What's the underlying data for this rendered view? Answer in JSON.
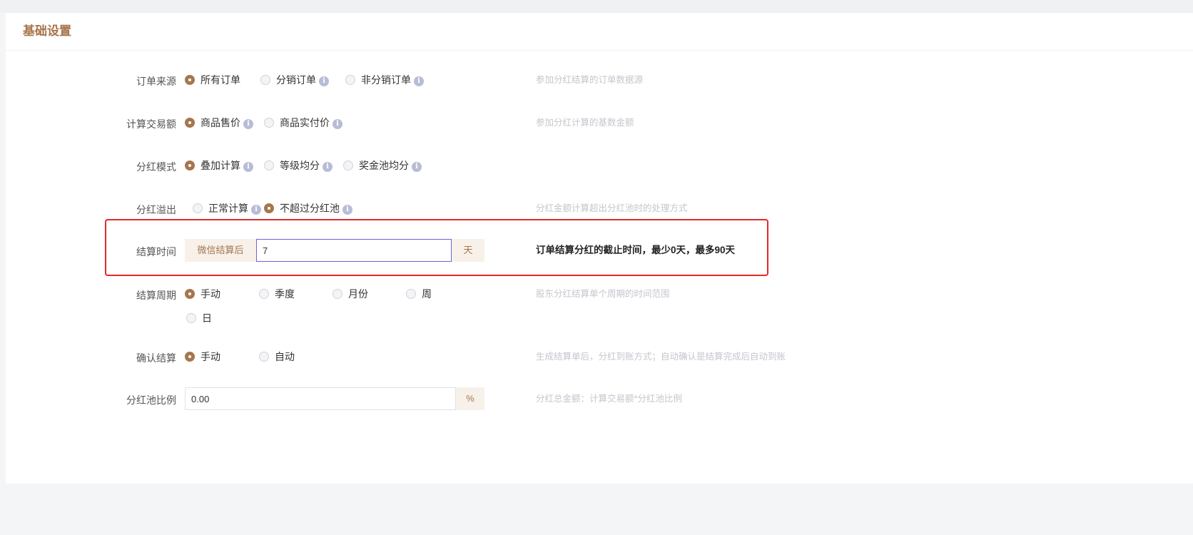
{
  "page": {
    "section_title": "基础设置"
  },
  "form": {
    "order_source": {
      "label": "订单来源",
      "options": [
        "所有订单",
        "分销订单",
        "非分销订单"
      ],
      "selected": "所有订单",
      "hint": "参加分红结算的订单数据源"
    },
    "trade_amount": {
      "label": "计算交易额",
      "options": [
        "商品售价",
        "商品实付价"
      ],
      "selected": "商品售价",
      "hint": "参加分红计算的基数金额"
    },
    "bonus_mode": {
      "label": "分红模式",
      "options": [
        "叠加计算",
        "等级均分",
        "奖金池均分"
      ],
      "selected": "叠加计算",
      "hint": ""
    },
    "bonus_overflow": {
      "label": "分红溢出",
      "options": [
        "正常计算",
        "不超过分红池"
      ],
      "selected": "不超过分红池",
      "hint": "分红金额计算超出分红池时的处理方式"
    },
    "settle_time": {
      "label": "结算时间",
      "prefix": "微信结算后",
      "value": "7",
      "suffix": "天",
      "hint": "订单结算分红的截止时间，最少0天，最多90天"
    },
    "settle_cycle": {
      "label": "结算周期",
      "options": [
        "手动",
        "季度",
        "月份",
        "周",
        "日"
      ],
      "selected": "手动",
      "hint": "股东分红结算单个周期的时间范围"
    },
    "confirm_settle": {
      "label": "确认结算",
      "options": [
        "手动",
        "自动"
      ],
      "selected": "手动",
      "hint": "生成结算单后，分红到账方式；自动确认是结算完成后自动到账"
    },
    "pool_ratio": {
      "label": "分红池比例",
      "value": "0.00",
      "suffix": "%",
      "hint": "分红总金额：计算交易额*分红池比例"
    }
  },
  "icons": {
    "info": "info-icon"
  },
  "colors": {
    "accent": "#a5774e",
    "title": "#a8744a",
    "highlight": "#e02a28",
    "focus": "#6a63de"
  }
}
